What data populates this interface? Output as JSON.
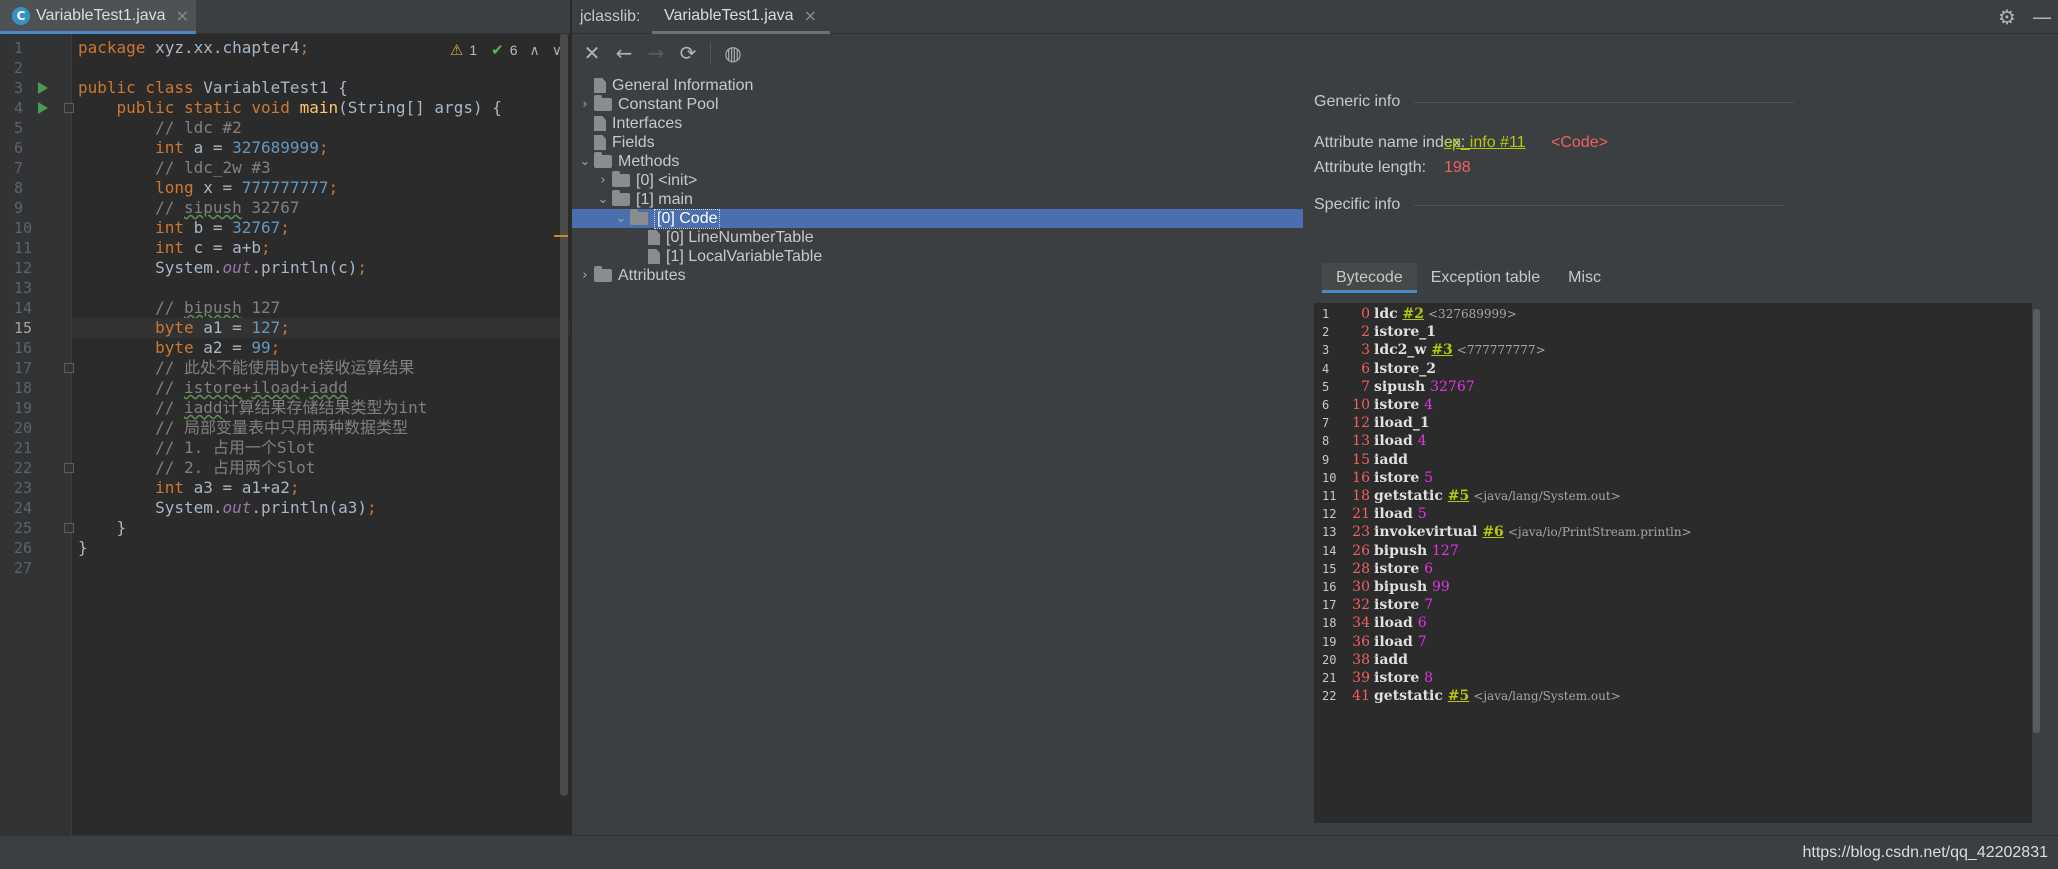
{
  "editor": {
    "tab_label": "VariableTest1.java",
    "tab_icon": "C",
    "inspections": {
      "warnings": "1",
      "ok": "6"
    },
    "current_line": 15,
    "line_numbers": [
      "1",
      "2",
      "3",
      "4",
      "5",
      "6",
      "7",
      "8",
      "9",
      "10",
      "11",
      "12",
      "13",
      "14",
      "15",
      "16",
      "17",
      "18",
      "19",
      "20",
      "21",
      "22",
      "23",
      "24",
      "25",
      "26",
      "27"
    ],
    "lines": [
      [
        {
          "t": "package ",
          "c": "kw"
        },
        {
          "t": "xyz.xx.chapter4",
          "c": "plain"
        },
        {
          "t": ";",
          "c": "kw"
        }
      ],
      [],
      [
        {
          "t": "public class ",
          "c": "kw"
        },
        {
          "t": "VariableTest1 {",
          "c": "plain"
        }
      ],
      [
        {
          "t": "    public static void ",
          "c": "kw"
        },
        {
          "t": "main",
          "c": "fn"
        },
        {
          "t": "(String[] args) {",
          "c": "plain"
        }
      ],
      [
        {
          "t": "        // ldc #2",
          "c": "cmt"
        }
      ],
      [
        {
          "t": "        int ",
          "c": "kw"
        },
        {
          "t": "a = ",
          "c": "plain"
        },
        {
          "t": "327689999",
          "c": "num"
        },
        {
          "t": ";",
          "c": "kw"
        }
      ],
      [
        {
          "t": "        // ldc_2w #3",
          "c": "cmt"
        }
      ],
      [
        {
          "t": "        long ",
          "c": "kw"
        },
        {
          "t": "x = ",
          "c": "plain"
        },
        {
          "t": "777777777",
          "c": "num"
        },
        {
          "t": ";",
          "c": "kw"
        }
      ],
      [
        {
          "t": "        // ",
          "c": "cmt"
        },
        {
          "t": "sipush",
          "c": "cmt squig"
        },
        {
          "t": " 32767",
          "c": "cmt"
        }
      ],
      [
        {
          "t": "        int ",
          "c": "kw"
        },
        {
          "t": "b = ",
          "c": "plain"
        },
        {
          "t": "32767",
          "c": "num"
        },
        {
          "t": ";",
          "c": "kw"
        }
      ],
      [
        {
          "t": "        int ",
          "c": "kw"
        },
        {
          "t": "c = a+b",
          "c": "plain"
        },
        {
          "t": ";",
          "c": "kw"
        }
      ],
      [
        {
          "t": "        System.",
          "c": "plain"
        },
        {
          "t": "out",
          "c": "fld"
        },
        {
          "t": ".println(c)",
          "c": "plain"
        },
        {
          "t": ";",
          "c": "kw"
        }
      ],
      [],
      [
        {
          "t": "        // ",
          "c": "cmt"
        },
        {
          "t": "bipush",
          "c": "cmt squig"
        },
        {
          "t": " 127",
          "c": "cmt"
        }
      ],
      [
        {
          "t": "        byte ",
          "c": "kw"
        },
        {
          "t": "a1 = ",
          "c": "plain"
        },
        {
          "t": "127",
          "c": "num"
        },
        {
          "t": ";",
          "c": "kw"
        }
      ],
      [
        {
          "t": "        byte ",
          "c": "kw"
        },
        {
          "t": "a2 = ",
          "c": "plain"
        },
        {
          "t": "99",
          "c": "num"
        },
        {
          "t": ";",
          "c": "kw"
        }
      ],
      [
        {
          "t": "        // 此处不能使用byte接收运算结果",
          "c": "cmt"
        }
      ],
      [
        {
          "t": "        // ",
          "c": "cmt"
        },
        {
          "t": "istore",
          "c": "cmt squig"
        },
        {
          "t": "+",
          "c": "cmt"
        },
        {
          "t": "iload",
          "c": "cmt squig"
        },
        {
          "t": "+",
          "c": "cmt"
        },
        {
          "t": "iadd",
          "c": "cmt squig"
        }
      ],
      [
        {
          "t": "        // ",
          "c": "cmt"
        },
        {
          "t": "iadd",
          "c": "cmt squig"
        },
        {
          "t": "计算结果存储结果类型为int",
          "c": "cmt"
        }
      ],
      [
        {
          "t": "        // 局部变量表中只用两种数据类型",
          "c": "cmt"
        }
      ],
      [
        {
          "t": "        // 1. 占用一个Slot",
          "c": "cmt"
        }
      ],
      [
        {
          "t": "        // 2. 占用两个Slot",
          "c": "cmt"
        }
      ],
      [
        {
          "t": "        int ",
          "c": "kw"
        },
        {
          "t": "a3 = a1+a2",
          "c": "plain"
        },
        {
          "t": ";",
          "c": "kw"
        }
      ],
      [
        {
          "t": "        System.",
          "c": "plain"
        },
        {
          "t": "out",
          "c": "fld"
        },
        {
          "t": ".println(a3)",
          "c": "plain"
        },
        {
          "t": ";",
          "c": "kw"
        }
      ],
      [
        {
          "t": "    }",
          "c": "plain"
        }
      ],
      [
        {
          "t": "}",
          "c": "plain"
        }
      ],
      []
    ]
  },
  "jclasslib": {
    "title": "jclasslib:",
    "tab_label": "VariableTest1.java",
    "toolbar": [
      "close-icon",
      "back-icon",
      "forward-icon",
      "refresh-icon",
      "browser-icon"
    ],
    "tree": [
      {
        "label": "General Information",
        "icon": "page",
        "chev": "",
        "depth": 0
      },
      {
        "label": "Constant Pool",
        "icon": "folder",
        "chev": "›",
        "depth": 0
      },
      {
        "label": "Interfaces",
        "icon": "page",
        "chev": "",
        "depth": 0
      },
      {
        "label": "Fields",
        "icon": "page",
        "chev": "",
        "depth": 0
      },
      {
        "label": "Methods",
        "icon": "folder",
        "chev": "⌄",
        "depth": 0
      },
      {
        "label": "[0] <init>",
        "icon": "folder",
        "chev": "›",
        "depth": 1
      },
      {
        "label": "[1] main",
        "icon": "folder",
        "chev": "⌄",
        "depth": 1
      },
      {
        "label": "[0] Code",
        "icon": "folder",
        "chev": "⌄",
        "depth": 2,
        "selected": true
      },
      {
        "label": "[0] LineNumberTable",
        "icon": "page",
        "chev": "",
        "depth": 3
      },
      {
        "label": "[1] LocalVariableTable",
        "icon": "page",
        "chev": "",
        "depth": 3
      },
      {
        "label": "Attributes",
        "icon": "folder",
        "chev": "›",
        "depth": 0
      }
    ],
    "details": {
      "generic_info": "Generic info",
      "attr_name_index_label": "Attribute name index:",
      "attr_name_index_link": "cp_info #11",
      "attr_name_index_value": "<Code>",
      "attr_length_label": "Attribute length:",
      "attr_length_value": "198",
      "specific_info": "Specific info",
      "tabs": [
        "Bytecode",
        "Exception table",
        "Misc"
      ],
      "active_tab": "Bytecode"
    },
    "bytecode": [
      {
        "n": "1",
        "off": "0",
        "op": "ldc",
        "ref": "#2",
        "num": "",
        "cmt": "<327689999>"
      },
      {
        "n": "2",
        "off": "2",
        "op": "istore_1",
        "ref": "",
        "num": "",
        "cmt": ""
      },
      {
        "n": "3",
        "off": "3",
        "op": "ldc2_w",
        "ref": "#3",
        "num": "",
        "cmt": "<777777777>"
      },
      {
        "n": "4",
        "off": "6",
        "op": "lstore_2",
        "ref": "",
        "num": "",
        "cmt": ""
      },
      {
        "n": "5",
        "off": "7",
        "op": "sipush",
        "ref": "",
        "num": "32767",
        "cmt": ""
      },
      {
        "n": "6",
        "off": "10",
        "op": "istore",
        "ref": "",
        "num": "4",
        "cmt": ""
      },
      {
        "n": "7",
        "off": "12",
        "op": "iload_1",
        "ref": "",
        "num": "",
        "cmt": ""
      },
      {
        "n": "8",
        "off": "13",
        "op": "iload",
        "ref": "",
        "num": "4",
        "cmt": ""
      },
      {
        "n": "9",
        "off": "15",
        "op": "iadd",
        "ref": "",
        "num": "",
        "cmt": ""
      },
      {
        "n": "10",
        "off": "16",
        "op": "istore",
        "ref": "",
        "num": "5",
        "cmt": ""
      },
      {
        "n": "11",
        "off": "18",
        "op": "getstatic",
        "ref": "#5",
        "num": "",
        "cmt": "<java/lang/System.out>"
      },
      {
        "n": "12",
        "off": "21",
        "op": "iload",
        "ref": "",
        "num": "5",
        "cmt": ""
      },
      {
        "n": "13",
        "off": "23",
        "op": "invokevirtual",
        "ref": "#6",
        "num": "",
        "cmt": "<java/io/PrintStream.println>"
      },
      {
        "n": "14",
        "off": "26",
        "op": "bipush",
        "ref": "",
        "num": "127",
        "cmt": ""
      },
      {
        "n": "15",
        "off": "28",
        "op": "istore",
        "ref": "",
        "num": "6",
        "cmt": ""
      },
      {
        "n": "16",
        "off": "30",
        "op": "bipush",
        "ref": "",
        "num": "99",
        "cmt": ""
      },
      {
        "n": "17",
        "off": "32",
        "op": "istore",
        "ref": "",
        "num": "7",
        "cmt": ""
      },
      {
        "n": "18",
        "off": "34",
        "op": "iload",
        "ref": "",
        "num": "6",
        "cmt": ""
      },
      {
        "n": "19",
        "off": "36",
        "op": "iload",
        "ref": "",
        "num": "7",
        "cmt": ""
      },
      {
        "n": "20",
        "off": "38",
        "op": "iadd",
        "ref": "",
        "num": "",
        "cmt": ""
      },
      {
        "n": "21",
        "off": "39",
        "op": "istore",
        "ref": "",
        "num": "8",
        "cmt": ""
      },
      {
        "n": "22",
        "off": "41",
        "op": "getstatic",
        "ref": "#5",
        "num": "",
        "cmt": "<java/lang/System.out>"
      }
    ]
  },
  "watermark": "https://blog.csdn.net/qq_42202831"
}
